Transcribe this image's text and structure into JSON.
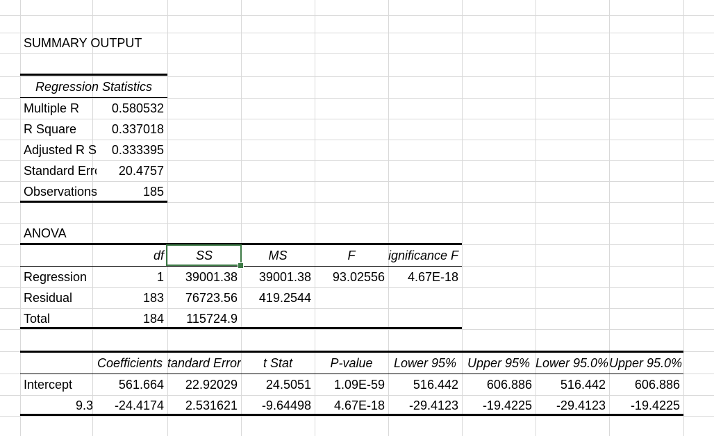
{
  "summary_title": "SUMMARY OUTPUT",
  "regression_statistics": {
    "header": "Regression Statistics",
    "rows": [
      {
        "label": "Multiple R",
        "value": "0.580532"
      },
      {
        "label": "R Square",
        "value": "0.337018"
      },
      {
        "label": "Adjusted R Square",
        "value": "0.333395"
      },
      {
        "label": "Standard Error",
        "value": "20.4757"
      },
      {
        "label": "Observations",
        "value": "185"
      }
    ]
  },
  "anova": {
    "title": "ANOVA",
    "headers": [
      "df",
      "SS",
      "MS",
      "F",
      "Significance F"
    ],
    "rows": [
      {
        "label": "Regression",
        "df": "1",
        "ss": "39001.38",
        "ms": "39001.38",
        "f": "93.02556",
        "sig": "4.67E-18"
      },
      {
        "label": "Residual",
        "df": "183",
        "ss": "76723.56",
        "ms": "419.2544",
        "f": "",
        "sig": ""
      },
      {
        "label": "Total",
        "df": "184",
        "ss": "115724.9",
        "ms": "",
        "f": "",
        "sig": ""
      }
    ]
  },
  "coefficients": {
    "headers": [
      "Coefficients",
      "Standard Error",
      "t Stat",
      "P-value",
      "Lower 95%",
      "Upper 95%",
      "Lower 95.0%",
      "Upper 95.0%"
    ],
    "rows": [
      {
        "label": "Intercept",
        "values": [
          "561.664",
          "22.92029",
          "24.5051",
          "1.09E-59",
          "516.442",
          "606.886",
          "516.442",
          "606.886"
        ]
      },
      {
        "label": "9.3",
        "values": [
          "-24.4174",
          "2.531621",
          "-9.64498",
          "4.67E-18",
          "-29.4123",
          "-19.4225",
          "-29.4123",
          "-19.4225"
        ]
      }
    ]
  },
  "selected_cell": "SS header",
  "colors": {
    "gridline": "#d9d9d9",
    "selection": "#3d7a46"
  }
}
